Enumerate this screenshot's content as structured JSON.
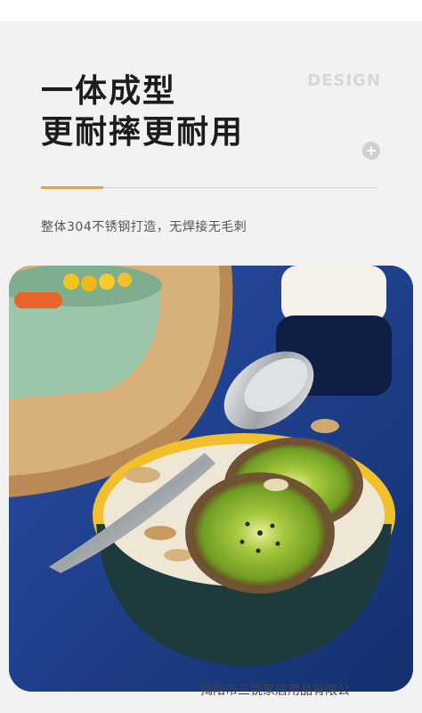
{
  "header": {
    "title_line1": "一体成型",
    "title_line2": "更耐摔更耐用",
    "design_label": "DESIGN",
    "subtitle": "整体304不锈钢打造，无焊接无毛刺"
  },
  "footer": {
    "company": "揭阳市三锐家居用品有限公"
  },
  "colors": {
    "accent": "#f3a21e",
    "photo_background": "#1b3a88"
  },
  "icons": [
    "plus-icon"
  ]
}
